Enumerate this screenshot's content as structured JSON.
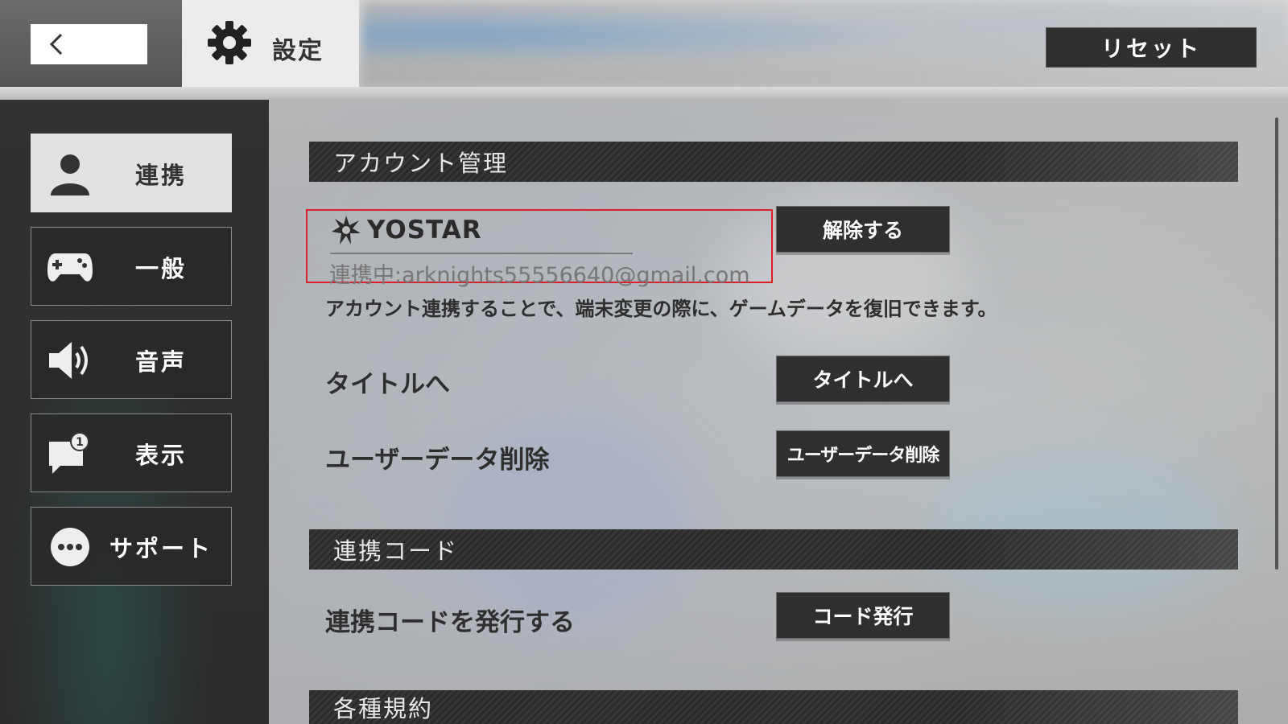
{
  "header": {
    "title": "設定",
    "reset_label": "リセット"
  },
  "sidebar": {
    "items": [
      {
        "label": "連携",
        "icon": "person-icon",
        "active": true
      },
      {
        "label": "一般",
        "icon": "gamepad-icon",
        "active": false
      },
      {
        "label": "音声",
        "icon": "speaker-icon",
        "active": false
      },
      {
        "label": "表示",
        "icon": "chat-bubble-notification-icon",
        "active": false
      },
      {
        "label": "サポート",
        "icon": "more-dots-icon",
        "active": false
      }
    ]
  },
  "main": {
    "account_section": {
      "header": "アカウント管理",
      "logo_text": "YOSTAR",
      "linked_email": "連携中:arknights55556640@gmail.com",
      "unlink_label": "解除する",
      "description": "アカウント連携することで、端末変更の際に、ゲームデータを復旧できます。",
      "rows": [
        {
          "label": "タイトルへ",
          "button": "タイトルへ"
        },
        {
          "label": "ユーザーデータ削除",
          "button": "ユーザーデータ削除"
        }
      ]
    },
    "code_section": {
      "header": "連携コード",
      "row_label": "連携コードを発行する",
      "button": "コード発行"
    },
    "terms_section": {
      "header": "各種規約"
    }
  },
  "colors": {
    "highlight_border": "#d9202a",
    "button_bg": "#2f2f2f",
    "sidebar_active_bg": "#e2e2e2"
  }
}
